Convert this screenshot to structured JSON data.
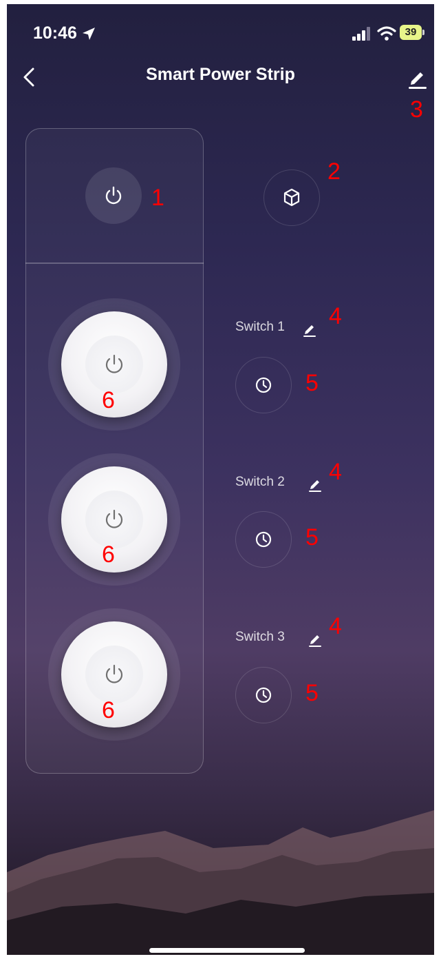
{
  "status_bar": {
    "time": "10:46",
    "battery": "39",
    "icons": [
      "location-arrow-icon",
      "signal-icon",
      "wifi-icon",
      "battery-icon"
    ]
  },
  "header": {
    "title": "Smart Power Strip",
    "back_icon": "chevron-left-icon",
    "edit_icon": "pencil-icon"
  },
  "controls": {
    "master_power_icon": "power-icon",
    "scene_icon": "cube-icon"
  },
  "switches": [
    {
      "label": "Switch 1",
      "edit_icon": "pencil-icon",
      "timer_icon": "clock-icon",
      "power_icon": "power-icon"
    },
    {
      "label": "Switch 2",
      "edit_icon": "pencil-icon",
      "timer_icon": "clock-icon",
      "power_icon": "power-icon"
    },
    {
      "label": "Switch 3",
      "edit_icon": "pencil-icon",
      "timer_icon": "clock-icon",
      "power_icon": "power-icon"
    }
  ],
  "annotations": {
    "master_power": "1",
    "scene": "2",
    "edit_name": "3",
    "rename_switch": "4",
    "timer": "5",
    "toggle_socket": "6"
  },
  "colors": {
    "annotation": "#ff0000",
    "battery": "#e8f58a",
    "background_top": "#22203f",
    "background_mid": "#4f3c64"
  }
}
